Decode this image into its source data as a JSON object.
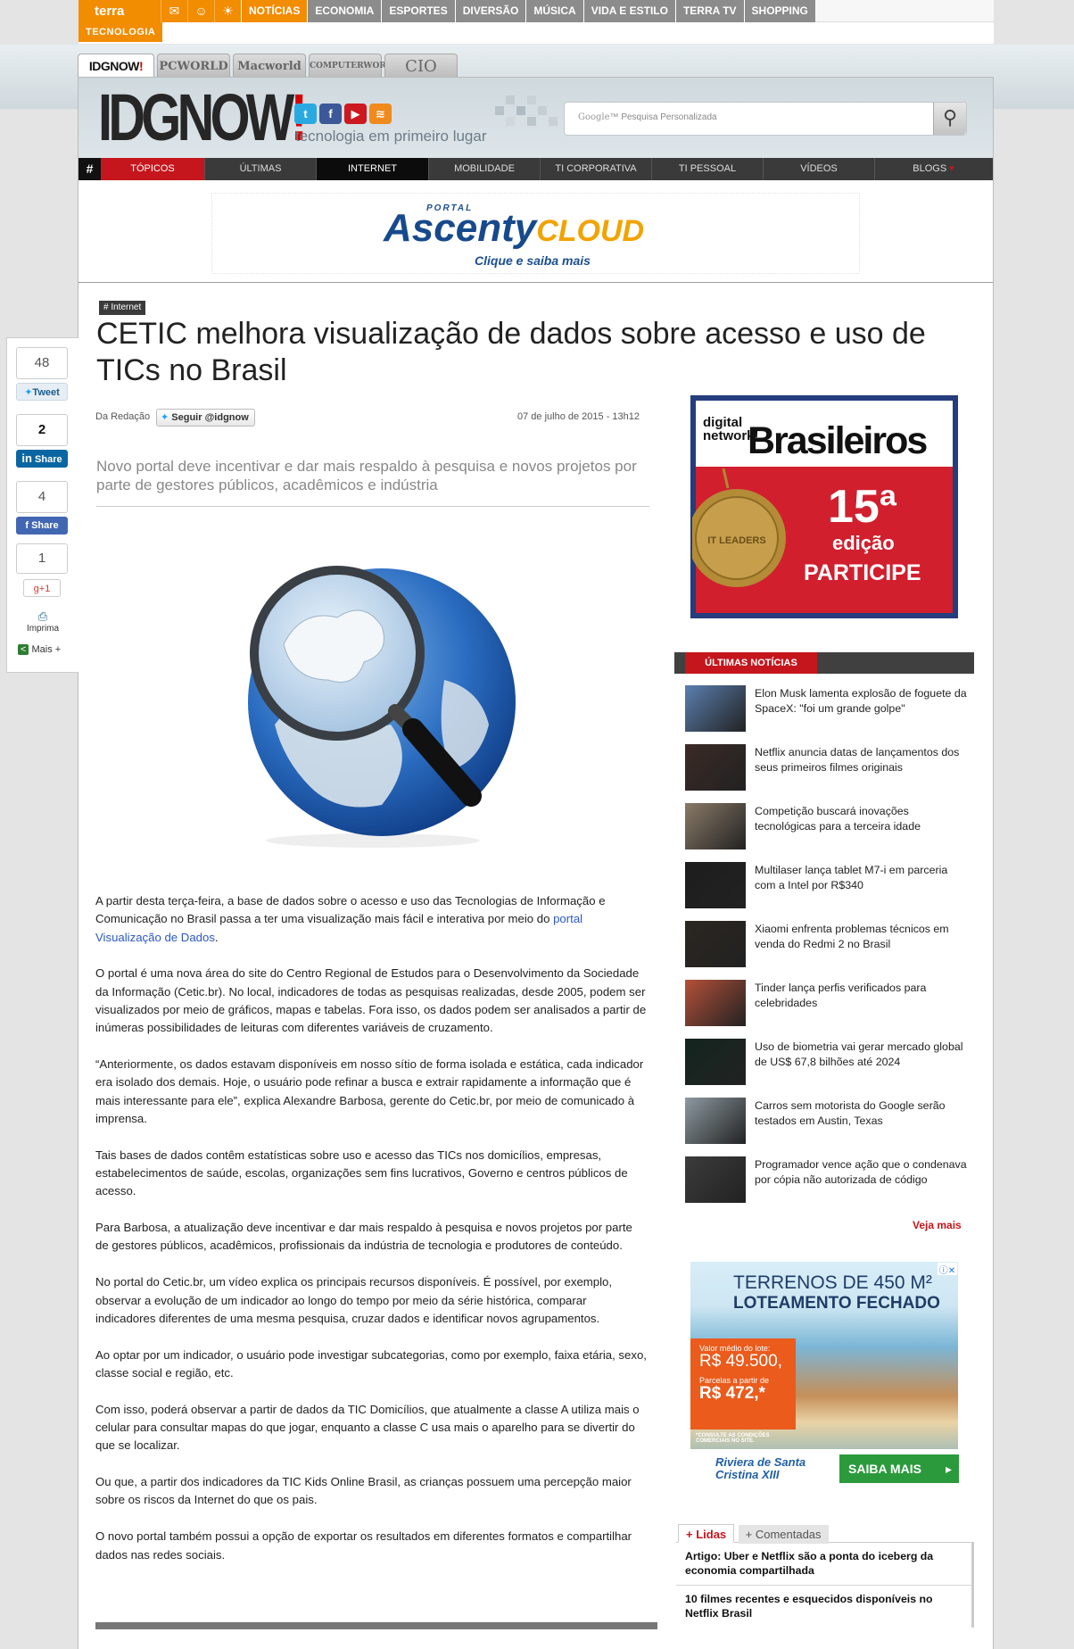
{
  "terra": {
    "logo": "terra",
    "icons": [
      "mail-icon",
      "smiley-icon",
      "sun-icon"
    ],
    "nav": [
      "NOTÍCIAS",
      "ECONOMIA",
      "ESPORTES",
      "DIVERSÃO",
      "MÚSICA",
      "VIDA E ESTILO",
      "TERRA TV",
      "SHOPPING"
    ],
    "section": "TECNOLOGIA",
    "accent": "#f28c00"
  },
  "site_tabs": [
    "IDGNOW!",
    "PCWORLD",
    "Macworld",
    "COMPUTERWORLD",
    "CIO"
  ],
  "header": {
    "logo": "IDGNOW",
    "logo_bang": "!",
    "tagline": "tecnologia em primeiro lugar",
    "search_brand": "Google",
    "search_placeholder": "Pesquisa Personalizada"
  },
  "nav": {
    "hash": "#",
    "items": [
      "TÓPICOS",
      "ÚLTIMAS",
      "INTERNET",
      "MOBILIDADE",
      "TI CORPORATIVA",
      "TI PESSOAL",
      "VÍDEOS",
      "BLOGS"
    ],
    "accent": "#c4161c"
  },
  "banner": {
    "portal": "PORTAL",
    "brand": "Ascenty",
    "brand2": "CLOUD",
    "cta": "Clique e saiba mais"
  },
  "share": {
    "tweet_count": "48",
    "tweet_label": "Tweet",
    "linkedin_count": "2",
    "linkedin_label": "Share",
    "facebook_count": "4",
    "facebook_label": "Share",
    "gplus_count": "1",
    "gplus_label": "+1",
    "print_label": "Imprima",
    "more_label": "Mais"
  },
  "article": {
    "tag": "Internet",
    "title": "CETIC melhora visualização de dados sobre acesso e uso de TICs no Brasil",
    "author": "Da Redação",
    "follow": "Seguir @idgnow",
    "date": "07 de julho de 2015 - 13h12",
    "lead": "Novo portal deve incentivar e dar mais respaldo à pesquisa e novos projetos por parte de gestores públicos, acadêmicos e indústria",
    "p1a": "A partir desta terça-feira, a base de dados sobre o acesso e uso das Tecnologias de Informação e Comunicação no Brasil passa a ter uma visualização mais fácil e interativa por meio do ",
    "p1link": "portal Visualização de Dados",
    "p1b": ".",
    "p2": "O portal é uma nova área do site do Centro Regional de Estudos para o Desenvolvimento da Sociedade da Informação (Cetic.br). No local, indicadores de todas as pesquisas realizadas, desde 2005, podem ser visualizados por meio de gráficos, mapas e tabelas. Fora isso, os dados podem ser analisados a partir de inúmeras possibilidades de leituras com diferentes variáveis de cruzamento.",
    "p3": "“Anteriormente, os dados estavam disponíveis em nosso sítio de forma isolada e estática, cada indicador era isolado dos demais. Hoje, o usuário pode refinar a busca e extrair rapidamente a informação que é mais interessante para ele”, explica Alexandre Barbosa, gerente do Cetic.br, por meio de comunicado à imprensa.",
    "p4": "Tais bases de dados contêm estatísticas sobre uso e acesso das TICs nos domicílios, empresas, estabelecimentos de saúde, escolas, organizações sem fins lucrativos, Governo e centros públicos de acesso.",
    "p5": "Para Barbosa, a atualização deve incentivar e dar mais respaldo à pesquisa e novos projetos por parte de gestores públicos, acadêmicos, profissionais da indústria de tecnologia e produtores de conteúdo.",
    "p6": "No portal do Cetic.br, um vídeo explica os principais recursos disponíveis. É possível, por exemplo, observar a evolução de um indicador ao longo do tempo por meio da série histórica, comparar indicadores diferentes de uma mesma pesquisa, cruzar dados e identificar novos agrupamentos.",
    "p7": "Ao optar por um indicador, o usuário pode investigar subcategorias, como por exemplo, faixa etária, sexo, classe social e região, etc.",
    "p8": "Com isso, poderá observar a partir de dados da TIC Domicílios, que atualmente a classe A utiliza mais o celular para consultar mapas do que jogar, enquanto a classe C usa mais o aparelho para se divertir do que se localizar.",
    "p9": "Ou que, a partir dos indicadores da TIC Kids Online Brasil, as crianças possuem uma percepção maior sobre os riscos da Internet do que os pais.",
    "p10": "O novo portal também possui a opção de exportar os resultados em diferentes formatos e compartilhar dados nas redes sociais."
  },
  "ad_dnb": {
    "brand_small_1": "digital",
    "brand_small_2": "network!",
    "brand_big": "Brasileiros",
    "edition_number": "15ª",
    "edition_label": "edição",
    "cta": "PARTICIPE",
    "medal_text": "IT LEADERS"
  },
  "ultimas": {
    "header": "ÚLTIMAS NOTÍCIAS",
    "items": [
      {
        "text": "Elon Musk lamenta explosão de foguete da SpaceX: \"foi um grande golpe\"",
        "thumb_color": "#5b7fb0"
      },
      {
        "text": "Netflix anuncia datas de lançamentos dos seus primeiros filmes originais",
        "thumb_color": "#3b2a26"
      },
      {
        "text": "Competição buscará inovações tecnológicas para a terceira idade",
        "thumb_color": "#8a7a68"
      },
      {
        "text": "Multilaser lança tablet M7-i em parceria com a Intel por R$340",
        "thumb_color": "#1d1d1d"
      },
      {
        "text": "Xiaomi enfrenta problemas técnicos em venda do Redmi 2 no Brasil",
        "thumb_color": "#2b2620"
      },
      {
        "text": "Tinder lança perfis verificados para celebridades",
        "thumb_color": "#b4503a"
      },
      {
        "text": "Uso de biometria vai gerar mercado global de US$ 67,8 bilhões até 2024",
        "thumb_color": "#13251f"
      },
      {
        "text": "Carros sem motorista do Google serão testados em Austin, Texas",
        "thumb_color": "#8d9aa1"
      },
      {
        "text": "Programador vence ação que o condenava por cópia não autorizada de código",
        "thumb_color": "#3c3c3c"
      }
    ],
    "more": "Veja mais"
  },
  "ad_terrenos": {
    "line1": "TERRENOS DE 450 M²",
    "line2": "LOTEAMENTO FECHADO",
    "price_label": "Valor médio do lote:",
    "price": "R$ 49.500,",
    "installment_label": "Parcelas a partir de",
    "installment": "R$ 472,*",
    "disclaimer": "*CONSULTE AS CONDIÇÕES COMERCIAIS NO SITE.",
    "brand": "Riviera de Santa Cristina XIII",
    "cta": "SAIBA MAIS"
  },
  "lidas": {
    "tab_active": "+ Lidas",
    "tab_other": "+ Comentadas",
    "items": [
      "Artigo: Uber e Netflix são a ponta do iceberg da economia compartilhada",
      "10 filmes recentes e esquecidos disponíveis no Netflix Brasil"
    ]
  }
}
